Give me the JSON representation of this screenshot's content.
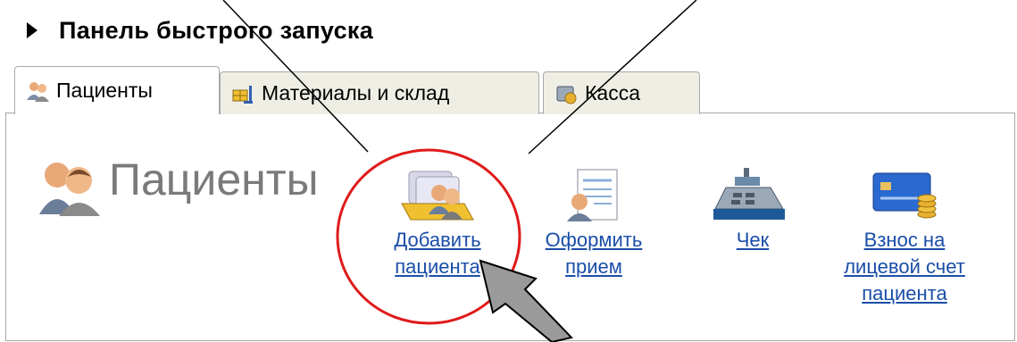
{
  "header": {
    "title": "Панель быстрого запуска"
  },
  "tabs": [
    {
      "label": "Пациенты",
      "icon": "patients-icon",
      "active": true
    },
    {
      "label": "Материалы и склад",
      "icon": "warehouse-icon",
      "active": false
    },
    {
      "label": "Касса",
      "icon": "cash-icon",
      "active": false
    }
  ],
  "section": {
    "title": "Пациенты",
    "icon": "patients-large-icon"
  },
  "actions": [
    {
      "label": "Добавить\nпациента",
      "icon": "add-patient-icon"
    },
    {
      "label": "Оформить\nприем",
      "icon": "appointment-form-icon"
    },
    {
      "label": "Чек",
      "icon": "cash-register-icon"
    },
    {
      "label": "Взнос на\nлицевой счет\nпациента",
      "icon": "deposit-card-icon"
    }
  ],
  "colors": {
    "link": "#1a4ea8",
    "highlight_circle": "#e01a1a",
    "pointer_arrow": "#9a9a9a",
    "tab_inactive_bg": "#efeee5"
  }
}
